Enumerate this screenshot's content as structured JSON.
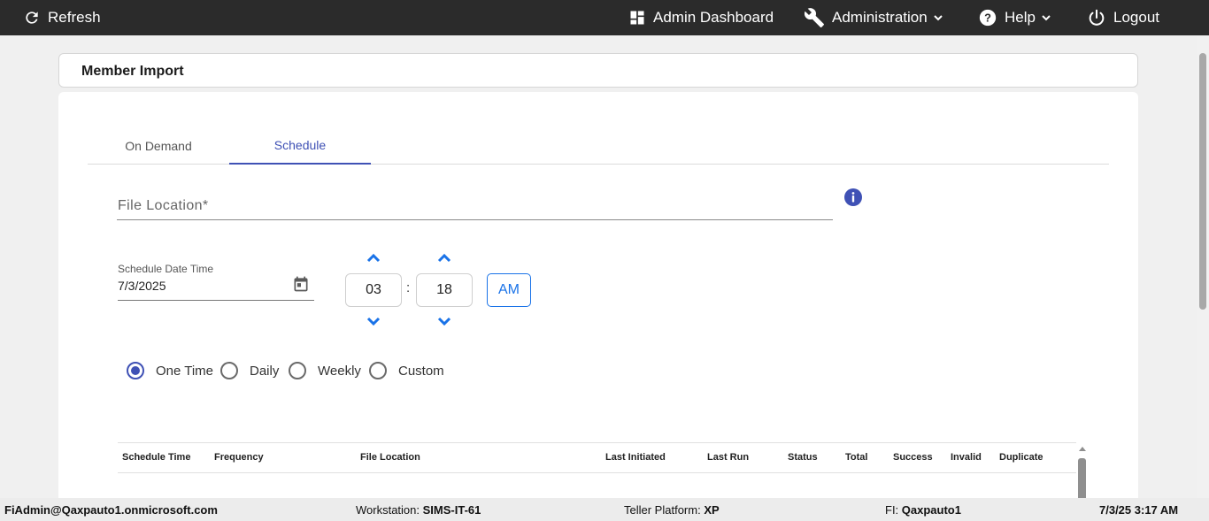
{
  "topbar": {
    "refresh": "Refresh",
    "admin_dashboard": "Admin Dashboard",
    "administration": "Administration",
    "help": "Help",
    "logout": "Logout"
  },
  "page": {
    "title": "Member Import"
  },
  "tabs": {
    "on_demand": "On Demand",
    "schedule": "Schedule",
    "active": "Schedule"
  },
  "form": {
    "file_location_placeholder": "File Location*",
    "schedule_label": "Schedule Date Time",
    "schedule_date": "7/3/2025",
    "hour": "03",
    "colon": ":",
    "minute": "18",
    "ampm": "AM"
  },
  "frequency": {
    "options": [
      "One Time",
      "Daily",
      "Weekly",
      "Custom"
    ],
    "selected": "One Time"
  },
  "table": {
    "columns": [
      "Schedule Time",
      "Frequency",
      "File Location",
      "Last Initiated",
      "Last Run",
      "Status",
      "Total",
      "Success",
      "Invalid",
      "Duplicate"
    ]
  },
  "status_bar": {
    "user": "FiAdmin@Qaxpauto1.onmicrosoft.com",
    "workstation_label": "Workstation:",
    "workstation": "SIMS-IT-61",
    "platform_label": "Teller Platform:",
    "platform": "XP",
    "fi_label": "FI:",
    "fi": "Qaxpauto1",
    "datetime": "7/3/25 3:17 AM"
  },
  "colors": {
    "topbar_bg": "#2b2b2b",
    "accent": "#3f51b5",
    "link_blue": "#1a73e8"
  }
}
